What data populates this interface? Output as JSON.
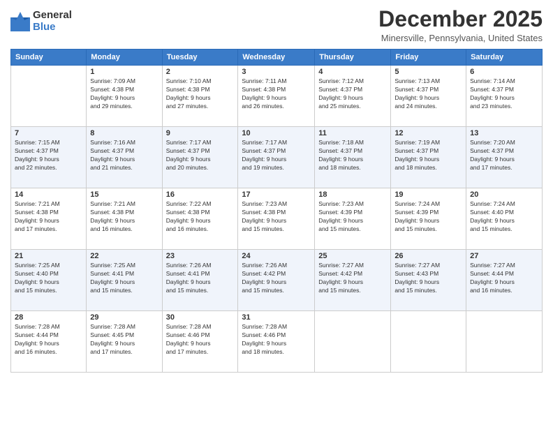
{
  "logo": {
    "general": "General",
    "blue": "Blue"
  },
  "title": "December 2025",
  "location": "Minersville, Pennsylvania, United States",
  "weekdays": [
    "Sunday",
    "Monday",
    "Tuesday",
    "Wednesday",
    "Thursday",
    "Friday",
    "Saturday"
  ],
  "weeks": [
    [
      {
        "num": "",
        "info": ""
      },
      {
        "num": "1",
        "info": "Sunrise: 7:09 AM\nSunset: 4:38 PM\nDaylight: 9 hours\nand 29 minutes."
      },
      {
        "num": "2",
        "info": "Sunrise: 7:10 AM\nSunset: 4:38 PM\nDaylight: 9 hours\nand 27 minutes."
      },
      {
        "num": "3",
        "info": "Sunrise: 7:11 AM\nSunset: 4:38 PM\nDaylight: 9 hours\nand 26 minutes."
      },
      {
        "num": "4",
        "info": "Sunrise: 7:12 AM\nSunset: 4:37 PM\nDaylight: 9 hours\nand 25 minutes."
      },
      {
        "num": "5",
        "info": "Sunrise: 7:13 AM\nSunset: 4:37 PM\nDaylight: 9 hours\nand 24 minutes."
      },
      {
        "num": "6",
        "info": "Sunrise: 7:14 AM\nSunset: 4:37 PM\nDaylight: 9 hours\nand 23 minutes."
      }
    ],
    [
      {
        "num": "7",
        "info": "Sunrise: 7:15 AM\nSunset: 4:37 PM\nDaylight: 9 hours\nand 22 minutes."
      },
      {
        "num": "8",
        "info": "Sunrise: 7:16 AM\nSunset: 4:37 PM\nDaylight: 9 hours\nand 21 minutes."
      },
      {
        "num": "9",
        "info": "Sunrise: 7:17 AM\nSunset: 4:37 PM\nDaylight: 9 hours\nand 20 minutes."
      },
      {
        "num": "10",
        "info": "Sunrise: 7:17 AM\nSunset: 4:37 PM\nDaylight: 9 hours\nand 19 minutes."
      },
      {
        "num": "11",
        "info": "Sunrise: 7:18 AM\nSunset: 4:37 PM\nDaylight: 9 hours\nand 18 minutes."
      },
      {
        "num": "12",
        "info": "Sunrise: 7:19 AM\nSunset: 4:37 PM\nDaylight: 9 hours\nand 18 minutes."
      },
      {
        "num": "13",
        "info": "Sunrise: 7:20 AM\nSunset: 4:37 PM\nDaylight: 9 hours\nand 17 minutes."
      }
    ],
    [
      {
        "num": "14",
        "info": "Sunrise: 7:21 AM\nSunset: 4:38 PM\nDaylight: 9 hours\nand 17 minutes."
      },
      {
        "num": "15",
        "info": "Sunrise: 7:21 AM\nSunset: 4:38 PM\nDaylight: 9 hours\nand 16 minutes."
      },
      {
        "num": "16",
        "info": "Sunrise: 7:22 AM\nSunset: 4:38 PM\nDaylight: 9 hours\nand 16 minutes."
      },
      {
        "num": "17",
        "info": "Sunrise: 7:23 AM\nSunset: 4:38 PM\nDaylight: 9 hours\nand 15 minutes."
      },
      {
        "num": "18",
        "info": "Sunrise: 7:23 AM\nSunset: 4:39 PM\nDaylight: 9 hours\nand 15 minutes."
      },
      {
        "num": "19",
        "info": "Sunrise: 7:24 AM\nSunset: 4:39 PM\nDaylight: 9 hours\nand 15 minutes."
      },
      {
        "num": "20",
        "info": "Sunrise: 7:24 AM\nSunset: 4:40 PM\nDaylight: 9 hours\nand 15 minutes."
      }
    ],
    [
      {
        "num": "21",
        "info": "Sunrise: 7:25 AM\nSunset: 4:40 PM\nDaylight: 9 hours\nand 15 minutes."
      },
      {
        "num": "22",
        "info": "Sunrise: 7:25 AM\nSunset: 4:41 PM\nDaylight: 9 hours\nand 15 minutes."
      },
      {
        "num": "23",
        "info": "Sunrise: 7:26 AM\nSunset: 4:41 PM\nDaylight: 9 hours\nand 15 minutes."
      },
      {
        "num": "24",
        "info": "Sunrise: 7:26 AM\nSunset: 4:42 PM\nDaylight: 9 hours\nand 15 minutes."
      },
      {
        "num": "25",
        "info": "Sunrise: 7:27 AM\nSunset: 4:42 PM\nDaylight: 9 hours\nand 15 minutes."
      },
      {
        "num": "26",
        "info": "Sunrise: 7:27 AM\nSunset: 4:43 PM\nDaylight: 9 hours\nand 15 minutes."
      },
      {
        "num": "27",
        "info": "Sunrise: 7:27 AM\nSunset: 4:44 PM\nDaylight: 9 hours\nand 16 minutes."
      }
    ],
    [
      {
        "num": "28",
        "info": "Sunrise: 7:28 AM\nSunset: 4:44 PM\nDaylight: 9 hours\nand 16 minutes."
      },
      {
        "num": "29",
        "info": "Sunrise: 7:28 AM\nSunset: 4:45 PM\nDaylight: 9 hours\nand 17 minutes."
      },
      {
        "num": "30",
        "info": "Sunrise: 7:28 AM\nSunset: 4:46 PM\nDaylight: 9 hours\nand 17 minutes."
      },
      {
        "num": "31",
        "info": "Sunrise: 7:28 AM\nSunset: 4:46 PM\nDaylight: 9 hours\nand 18 minutes."
      },
      {
        "num": "",
        "info": ""
      },
      {
        "num": "",
        "info": ""
      },
      {
        "num": "",
        "info": ""
      }
    ]
  ]
}
